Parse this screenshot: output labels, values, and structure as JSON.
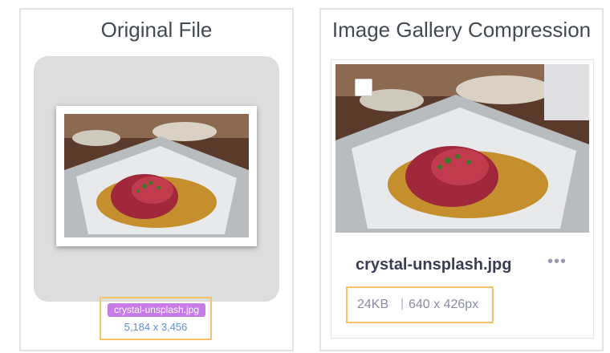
{
  "original": {
    "title": "Original File",
    "filename": "crystal-unsplash.jpg",
    "dimensions": "5,184 x 3,456"
  },
  "compressed": {
    "title": "Image Gallery Compression",
    "filename": "crystal-unsplash.jpg",
    "size": "24KB",
    "separator": "|",
    "dimensions": "640 x 426px",
    "more_icon": "more-horizontal-icon"
  },
  "colors": {
    "highlight_border": "#f6c36a",
    "filename_badge": "#c77be6",
    "dimension_text": "#5c8fd1",
    "preview_bg": "#dddddd"
  }
}
